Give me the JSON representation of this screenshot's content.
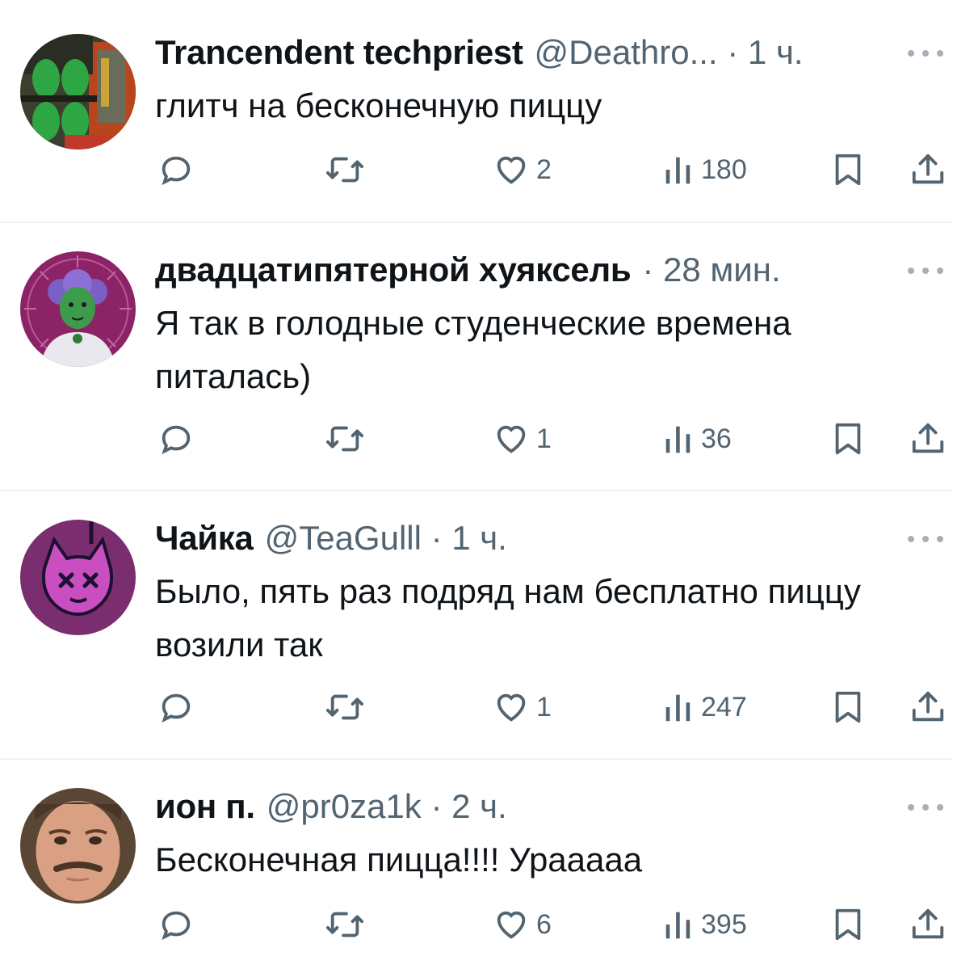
{
  "colors": {
    "text": "#0f1419",
    "secondary": "#536471",
    "divider": "#eff3f4"
  },
  "icons": {
    "reply": "speech-bubble-icon",
    "retweet": "retweet-icon",
    "like": "heart-icon",
    "views": "bar-chart-icon",
    "bookmark": "bookmark-icon",
    "share": "share-icon",
    "more": "more-dots-icon"
  },
  "tweets": [
    {
      "display_name": "Trancendent techpriest",
      "meta": "@Deathro... · 1 ч.",
      "text": "глитч на бесконечную пиццу",
      "likes": "2",
      "views": "180"
    },
    {
      "display_name": "двадцатипятерной хуяксель",
      "meta": "· 28 мин.",
      "text": "Я так в голодные студенческие времена питалась)",
      "likes": "1",
      "views": "36"
    },
    {
      "display_name": "Чайка",
      "meta": "@TeaGulll · 1 ч.",
      "text": "Было, пять раз подряд нам бесплатно пиццу возили так",
      "likes": "1",
      "views": "247"
    },
    {
      "display_name": "ион п.",
      "meta": "@pr0za1k · 2 ч.",
      "text": "Бесконечная пицца!!!! Урааааа",
      "likes": "6",
      "views": "395"
    }
  ]
}
